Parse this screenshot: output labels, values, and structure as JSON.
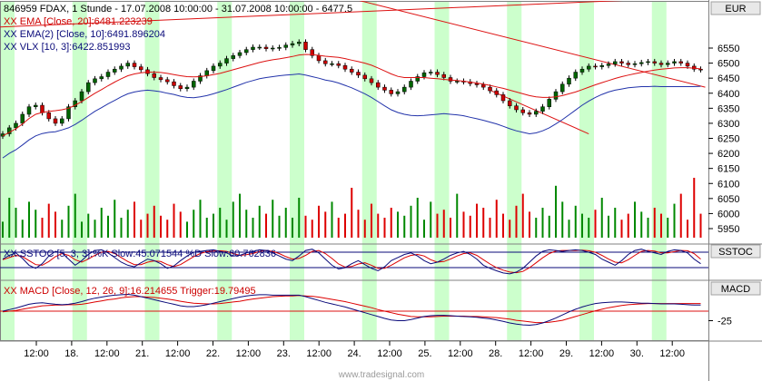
{
  "colors": {
    "background": "#ffffff",
    "session_band": "#ccffcc",
    "candle_up": "#006400",
    "candle_down": "#cc0000",
    "ema20": "#dd1111",
    "ema10": "#0a0a7a",
    "vlx": "#2233aa",
    "trendline": "#dd1111",
    "volume_up": "#008800",
    "volume_down": "#dd0000",
    "stoch_k": "#0a0a7a",
    "stoch_d": "#dd0000",
    "macd": "#0a0a7a",
    "macd_trigger": "#dd0000"
  },
  "chart_data": [
    {
      "type": "candlestick",
      "title": "846959  FDAX, 1 Stunde - 17.07.2008 10:00:00 - 31.07.2008 10:00:00 - 6477.5",
      "currency_label": "EUR",
      "ylim": [
        5900,
        6650
      ],
      "y_ticks": [
        5950,
        6000,
        6050,
        6100,
        6150,
        6200,
        6250,
        6300,
        6350,
        6400,
        6450,
        6500,
        6550
      ],
      "volume_axis_ticks": [
        5950,
        6000
      ],
      "legend": [
        {
          "label": "XX EMA [Close, 20]:6481.223239",
          "value": 6481.223239
        },
        {
          "label": "XX EMA(2) [Close, 10]:6491.896204",
          "value": 6491.896204
        },
        {
          "label": "XX VLX [10, 3]:6422.851993",
          "value": 6422.851993
        }
      ],
      "x_labels": [
        "12:00",
        "18.",
        "12:00",
        "21.",
        "12:00",
        "22.",
        "12:00",
        "23.",
        "12:00",
        "24.",
        "12:00",
        "25.",
        "12:00",
        "28.",
        "12:00",
        "29.",
        "12:00",
        "30.",
        "12:00"
      ],
      "close": [
        6265,
        6285,
        6300,
        6330,
        6355,
        6360,
        6335,
        6315,
        6300,
        6315,
        6355,
        6375,
        6405,
        6435,
        6448,
        6455,
        6470,
        6480,
        6490,
        6500,
        6488,
        6478,
        6465,
        6452,
        6445,
        6438,
        6425,
        6415,
        6420,
        6440,
        6458,
        6475,
        6490,
        6500,
        6515,
        6525,
        6535,
        6545,
        6553,
        6553,
        6548,
        6550,
        6552,
        6560,
        6565,
        6570,
        6545,
        6525,
        6508,
        6498,
        6498,
        6492,
        6480,
        6470,
        6460,
        6448,
        6435,
        6420,
        6410,
        6398,
        6405,
        6420,
        6440,
        6455,
        6468,
        6470,
        6462,
        6452,
        6440,
        6440,
        6438,
        6432,
        6428,
        6420,
        6408,
        6395,
        6375,
        6358,
        6345,
        6335,
        6330,
        6340,
        6355,
        6380,
        6405,
        6430,
        6450,
        6470,
        6480,
        6490,
        6488,
        6492,
        6497,
        6505,
        6500,
        6495,
        6498,
        6502,
        6505,
        6500,
        6495,
        6500,
        6505,
        6500,
        6490,
        6480,
        6478
      ],
      "vol": [
        8,
        20,
        15,
        9,
        18,
        14,
        10,
        17,
        13,
        9,
        16,
        22,
        8,
        12,
        9,
        15,
        11,
        19,
        10,
        14,
        18,
        9,
        12,
        16,
        11,
        9,
        17,
        13,
        8,
        14,
        19,
        10,
        12,
        15,
        9,
        18,
        22,
        14,
        10,
        16,
        12,
        19,
        11,
        15,
        10,
        20,
        11,
        9,
        16,
        13,
        18,
        10,
        12,
        25,
        14,
        9,
        17,
        12,
        10,
        15,
        13,
        11,
        16,
        20,
        9,
        18,
        12,
        14,
        10,
        22,
        13,
        11,
        17,
        15,
        10,
        19,
        12,
        9,
        16,
        22,
        13,
        10,
        15,
        11,
        26,
        18,
        9,
        16,
        12,
        10,
        14,
        20,
        11,
        15,
        9,
        12,
        18,
        13,
        10,
        15,
        12,
        10,
        17,
        22,
        9,
        30,
        12
      ],
      "ema20": [
        6258,
        6270,
        6282,
        6298,
        6316,
        6330,
        6336,
        6340,
        6342,
        6345,
        6350,
        6360,
        6372,
        6386,
        6400,
        6412,
        6425,
        6437,
        6448,
        6458,
        6464,
        6468,
        6470,
        6470,
        6469,
        6466,
        6462,
        6458,
        6455,
        6454,
        6455,
        6458,
        6462,
        6466,
        6472,
        6478,
        6484,
        6490,
        6496,
        6502,
        6507,
        6511,
        6514,
        6518,
        6522,
        6527,
        6529,
        6528,
        6526,
        6523,
        6521,
        6519,
        6515,
        6510,
        6505,
        6500,
        6493,
        6484,
        6474,
        6464,
        6456,
        6452,
        6452,
        6452,
        6452,
        6450,
        6448,
        6446,
        6444,
        6442,
        6440,
        6437,
        6434,
        6430,
        6426,
        6421,
        6416,
        6410,
        6404,
        6398,
        6392,
        6388,
        6386,
        6386,
        6388,
        6392,
        6398,
        6404,
        6412,
        6420,
        6428,
        6435,
        6442,
        6449,
        6455,
        6460,
        6465,
        6469,
        6473,
        6477,
        6480,
        6482,
        6484,
        6485,
        6485,
        6483,
        6481
      ],
      "vlx": [
        6185,
        6200,
        6212,
        6228,
        6245,
        6258,
        6266,
        6270,
        6272,
        6278,
        6285,
        6296,
        6310,
        6325,
        6340,
        6352,
        6365,
        6376,
        6388,
        6398,
        6404,
        6408,
        6410,
        6408,
        6405,
        6400,
        6396,
        6390,
        6386,
        6385,
        6388,
        6392,
        6398,
        6405,
        6412,
        6420,
        6428,
        6436,
        6442,
        6448,
        6452,
        6455,
        6458,
        6460,
        6462,
        6464,
        6460,
        6455,
        6450,
        6444,
        6440,
        6434,
        6426,
        6418,
        6408,
        6398,
        6386,
        6372,
        6358,
        6345,
        6336,
        6330,
        6326,
        6325,
        6326,
        6328,
        6330,
        6332,
        6330,
        6328,
        6325,
        6320,
        6315,
        6310,
        6304,
        6298,
        6290,
        6282,
        6275,
        6270,
        6265,
        6268,
        6275,
        6285,
        6298,
        6312,
        6328,
        6344,
        6360,
        6374,
        6386,
        6396,
        6404,
        6410,
        6414,
        6418,
        6420,
        6422,
        6422,
        6423,
        6422,
        6422,
        6422,
        6422,
        6422,
        6422,
        6423
      ]
    },
    {
      "type": "line",
      "panel_label": "SSTOC",
      "title": "XX SSTOC [5, 3, 3]:%K Slow:45.071544 %D Slow:60.762836",
      "series": [
        {
          "name": "%K Slow",
          "value": 45.071544
        },
        {
          "name": "%D Slow",
          "value": 60.762836
        }
      ],
      "ylim": [
        0,
        100
      ],
      "k": [
        60,
        72,
        80,
        62,
        40,
        30,
        45,
        70,
        85,
        80,
        60,
        40,
        55,
        75,
        88,
        90,
        80,
        65,
        50,
        40,
        35,
        48,
        60,
        55,
        45,
        30,
        38,
        55,
        70,
        82,
        85,
        88,
        90,
        85,
        80,
        70,
        72,
        80,
        85,
        90,
        88,
        80,
        70,
        60,
        55,
        70,
        88,
        92,
        80,
        60,
        40,
        28,
        32,
        45,
        55,
        42,
        30,
        22,
        35,
        55,
        65,
        75,
        80,
        70,
        55,
        45,
        50,
        60,
        72,
        80,
        85,
        75,
        60,
        40,
        30,
        22,
        15,
        12,
        18,
        30,
        50,
        70,
        85,
        90,
        88,
        85,
        88,
        90,
        88,
        82,
        75,
        60,
        50,
        40,
        55,
        75,
        88,
        92,
        85,
        80,
        75,
        85,
        90,
        88,
        80,
        60,
        45
      ],
      "d": [
        58,
        65,
        72,
        68,
        55,
        42,
        40,
        52,
        68,
        78,
        72,
        58,
        50,
        60,
        72,
        82,
        85,
        78,
        65,
        52,
        42,
        42,
        50,
        54,
        52,
        42,
        36,
        42,
        55,
        68,
        78,
        84,
        86,
        87,
        85,
        78,
        72,
        74,
        78,
        85,
        88,
        85,
        78,
        68,
        60,
        62,
        72,
        85,
        88,
        78,
        62,
        44,
        34,
        36,
        44,
        48,
        40,
        30,
        30,
        40,
        52,
        64,
        72,
        75,
        70,
        58,
        50,
        52,
        60,
        70,
        78,
        80,
        72,
        58,
        44,
        32,
        24,
        18,
        16,
        20,
        32,
        48,
        64,
        78,
        86,
        88,
        88,
        88,
        89,
        87,
        82,
        72,
        60,
        50,
        48,
        58,
        72,
        85,
        88,
        86,
        80,
        80,
        84,
        88,
        87,
        78,
        60
      ]
    },
    {
      "type": "line",
      "panel_label": "MACD",
      "title": "XX MACD [Close, 12, 26, 9]:16.214655 Trigger:19.79495",
      "series": [
        {
          "name": "MACD",
          "value": 16.214655
        },
        {
          "name": "Trigger",
          "value": 19.79495
        }
      ],
      "ylim": [
        -45,
        55
      ],
      "y_ticks": [
        -25
      ],
      "macd": [
        0,
        4,
        8,
        13,
        18,
        21,
        22,
        20,
        18,
        17,
        18,
        21,
        25,
        30,
        34,
        37,
        40,
        42,
        43,
        44,
        42,
        38,
        34,
        30,
        26,
        22,
        18,
        14,
        12,
        12,
        14,
        17,
        21,
        25,
        29,
        33,
        37,
        40,
        42,
        43,
        43,
        42,
        42,
        42,
        42,
        42,
        38,
        33,
        28,
        23,
        19,
        15,
        11,
        6,
        1,
        -4,
        -9,
        -14,
        -19,
        -23,
        -25,
        -25,
        -22,
        -18,
        -14,
        -12,
        -11,
        -11,
        -12,
        -13,
        -14,
        -15,
        -16,
        -18,
        -20,
        -23,
        -27,
        -31,
        -34,
        -36,
        -37,
        -35,
        -31,
        -25,
        -18,
        -10,
        -2,
        5,
        11,
        16,
        20,
        22,
        23,
        24,
        24,
        23,
        22,
        21,
        21,
        20,
        19,
        19,
        19,
        18,
        17,
        16,
        16
      ],
      "trigger": [
        -2,
        0,
        2,
        5,
        8,
        11,
        14,
        15,
        16,
        16,
        17,
        17,
        18,
        21,
        24,
        27,
        30,
        32,
        35,
        37,
        38,
        38,
        37,
        36,
        34,
        32,
        29,
        26,
        23,
        21,
        20,
        19,
        19,
        20,
        22,
        24,
        26,
        29,
        32,
        34,
        36,
        38,
        39,
        40,
        40,
        41,
        40,
        39,
        37,
        34,
        31,
        28,
        25,
        21,
        17,
        13,
        9,
        4,
        0,
        -4,
        -8,
        -11,
        -14,
        -15,
        -15,
        -15,
        -14,
        -13,
        -13,
        -13,
        -13,
        -14,
        -14,
        -15,
        -16,
        -17,
        -19,
        -21,
        -24,
        -26,
        -28,
        -30,
        -30,
        -29,
        -27,
        -24,
        -19,
        -14,
        -9,
        -4,
        1,
        5,
        9,
        12,
        15,
        17,
        18,
        19,
        20,
        20,
        20,
        20,
        20,
        20,
        20,
        20,
        20
      ]
    }
  ],
  "watermark": "www.tradesignal.com"
}
